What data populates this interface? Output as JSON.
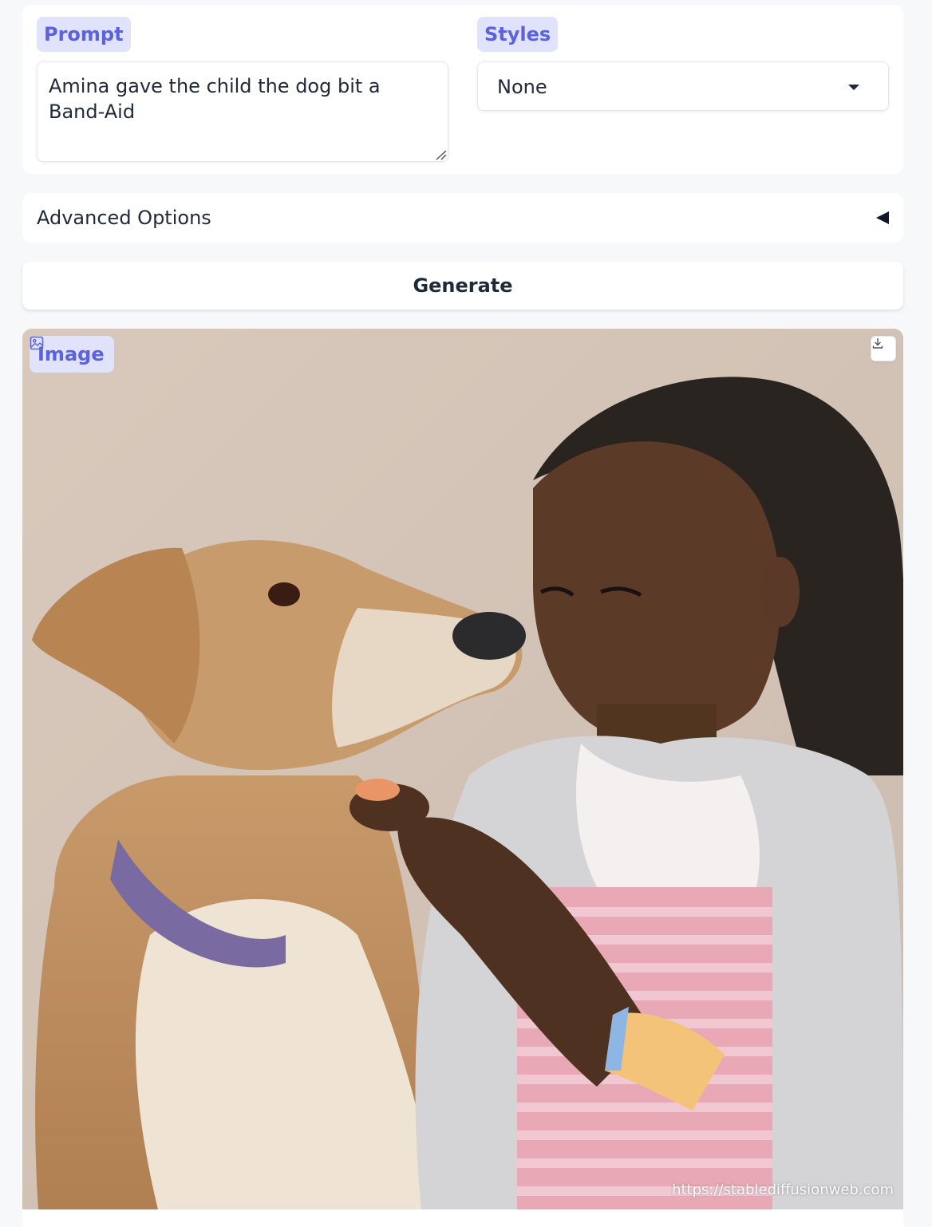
{
  "prompt": {
    "label": "Prompt",
    "value": "Amina gave the child the dog bit a Band-Aid"
  },
  "styles": {
    "label": "Styles",
    "selected": "None"
  },
  "advanced": {
    "label": "Advanced Options"
  },
  "generate": {
    "label": "Generate"
  },
  "output": {
    "label": "Image",
    "watermark": "https://stablediffusionweb.com",
    "icons": [
      "image-icon",
      "download-icon"
    ]
  },
  "colors": {
    "accent": "#5a62e0",
    "chip_background": "#e0e3fb",
    "page_background": "#f7f8fa"
  }
}
